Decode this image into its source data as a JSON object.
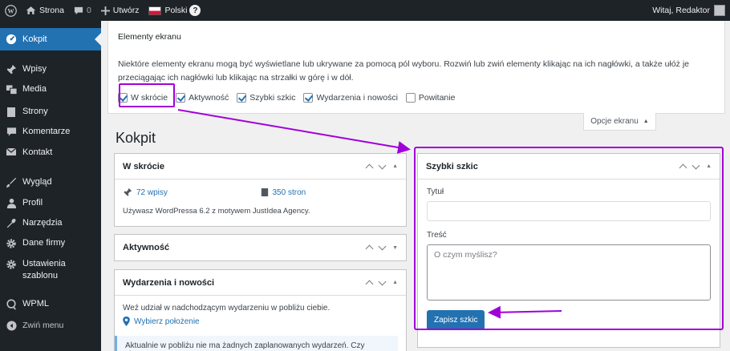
{
  "adminbar": {
    "site_name": "Strona",
    "comments_count": "0",
    "new_label": "Utwórz",
    "language": "Polski",
    "greeting": "Witaj, Redaktor",
    "icons": [
      "wordpress-logo",
      "home-icon",
      "comment-icon",
      "plus-icon",
      "flag-pl",
      "help-icon",
      "avatar"
    ]
  },
  "sidebar": {
    "items": [
      {
        "label": "Kokpit",
        "icon": "dashboard-icon",
        "active": true
      },
      {
        "label": "Wpisy",
        "icon": "pin-icon"
      },
      {
        "label": "Media",
        "icon": "media-icon"
      },
      {
        "label": "Strony",
        "icon": "pages-icon"
      },
      {
        "label": "Komentarze",
        "icon": "comment-icon"
      },
      {
        "label": "Kontakt",
        "icon": "mail-icon"
      },
      {
        "label": "Wygląd",
        "icon": "brush-icon"
      },
      {
        "label": "Profil",
        "icon": "user-icon"
      },
      {
        "label": "Narzędzia",
        "icon": "wrench-icon"
      },
      {
        "label": "Dane firmy",
        "icon": "gear-icon"
      },
      {
        "label": "Ustawienia szablonu",
        "icon": "gear-icon"
      },
      {
        "label": "WPML",
        "icon": "wpml-icon"
      },
      {
        "label": "Zwiń menu",
        "icon": "collapse-icon"
      }
    ]
  },
  "screen_options": {
    "title": "Elementy ekranu",
    "description": "Niektóre elementy ekranu mogą być wyświetlane lub ukrywane za pomocą pól wyboru. Rozwiń lub zwiń elementy klikając na ich nagłówki, a także ułóż je przeciągając ich nagłówki lub klikając na strzałki w górę i w dół.",
    "checkboxes": [
      {
        "label": "W skrócie",
        "checked": true
      },
      {
        "label": "Aktywność",
        "checked": true
      },
      {
        "label": "Szybki szkic",
        "checked": true
      },
      {
        "label": "Wydarzenia i nowości",
        "checked": true
      },
      {
        "label": "Powitanie",
        "checked": false
      }
    ],
    "tab_label": "Opcje ekranu"
  },
  "page_title": "Kokpit",
  "widgets": {
    "at_a_glance": {
      "title": "W skrócie",
      "posts": "72 wpisy",
      "pages": "350 stron",
      "version_text": "Używasz WordPressa 6.2 z motywem JustIdea Agency."
    },
    "activity": {
      "title": "Aktywność"
    },
    "events": {
      "title": "Wydarzenia i nowości",
      "intro": "Weź udział w nadchodzącym wydarzeniu w pobliżu ciebie.",
      "location_link": "Wybierz położenie",
      "note": "Aktualnie w pobliżu nie ma żadnych zaplanowanych wydarzeń. Czy chcesz"
    },
    "quick_draft": {
      "title": "Szybki szkic",
      "title_label": "Tytuł",
      "content_label": "Treść",
      "content_placeholder": "O czym myślisz?",
      "save_label": "Zapisz szkic"
    }
  },
  "colors": {
    "admin_bg": "#1d2327",
    "accent": "#2271b1",
    "highlight": "#a100d8"
  }
}
